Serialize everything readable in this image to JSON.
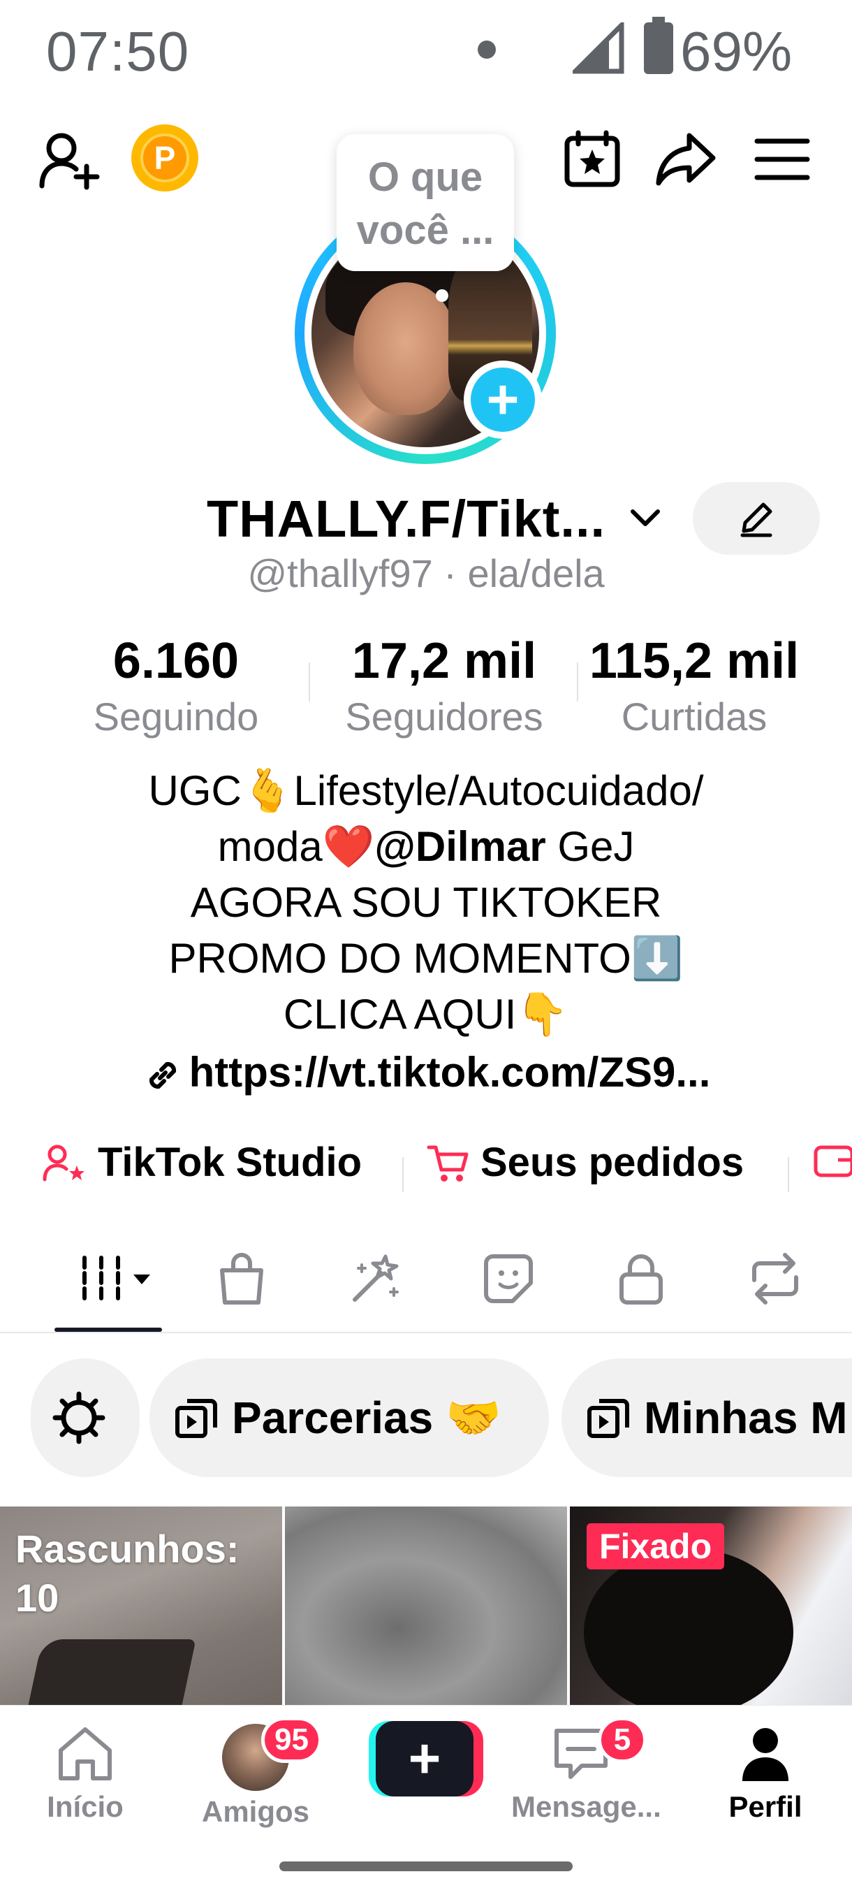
{
  "status_bar": {
    "time": "07:50",
    "battery": "69%"
  },
  "bubble": {
    "text": "O que você ..."
  },
  "profile": {
    "display_name": "THALLY.F/Tikt...",
    "username": "@thallyf97 · ela/dela"
  },
  "stats": [
    {
      "value": "6.160",
      "label": "Seguindo"
    },
    {
      "value": "17,2 mil",
      "label": "Seguidores"
    },
    {
      "value": "115,2 mil",
      "label": "Curtidas"
    }
  ],
  "bio": {
    "line1": "UGC🫰Lifestyle/Autocuidado/",
    "line2_prefix": "moda",
    "line2_heart": "❤️",
    "line2_mention": "@Dilmar",
    "line2_suffix": " GeJ",
    "line3": "AGORA SOU TIKTOKER",
    "line4": "PROMO DO MOMENTO⬇️",
    "line5": "CLICA AQUI👇",
    "link": "https://vt.tiktok.com/ZS9..."
  },
  "quick_actions": [
    {
      "label": "TikTok Studio",
      "icon": "person-star-icon"
    },
    {
      "label": "Seus pedidos",
      "icon": "cart-icon"
    },
    {
      "label": "",
      "icon": "wallet-icon"
    }
  ],
  "tabs": [
    {
      "icon": "grid-icon"
    },
    {
      "icon": "shopping-bag-icon"
    },
    {
      "icon": "sparkle-icon"
    },
    {
      "icon": "sticker-icon"
    },
    {
      "icon": "lock-icon"
    },
    {
      "icon": "repost-icon"
    }
  ],
  "chips": [
    {
      "label": "Parcerias 🤝"
    },
    {
      "label": "Minhas M"
    }
  ],
  "videos": [
    {
      "label": "Rascunhos:\n10"
    },
    {
      "label": ""
    },
    {
      "badge": "Fixado"
    }
  ],
  "bottom_nav": {
    "home": "Início",
    "friends": "Amigos",
    "friends_badge": "95",
    "messages": "Mensage...",
    "messages_badge": "5",
    "profile": "Perfil"
  },
  "colors": {
    "accent": "#fe2c55",
    "ring": "#20c4f4",
    "text_secondary": "#8a8b91"
  }
}
